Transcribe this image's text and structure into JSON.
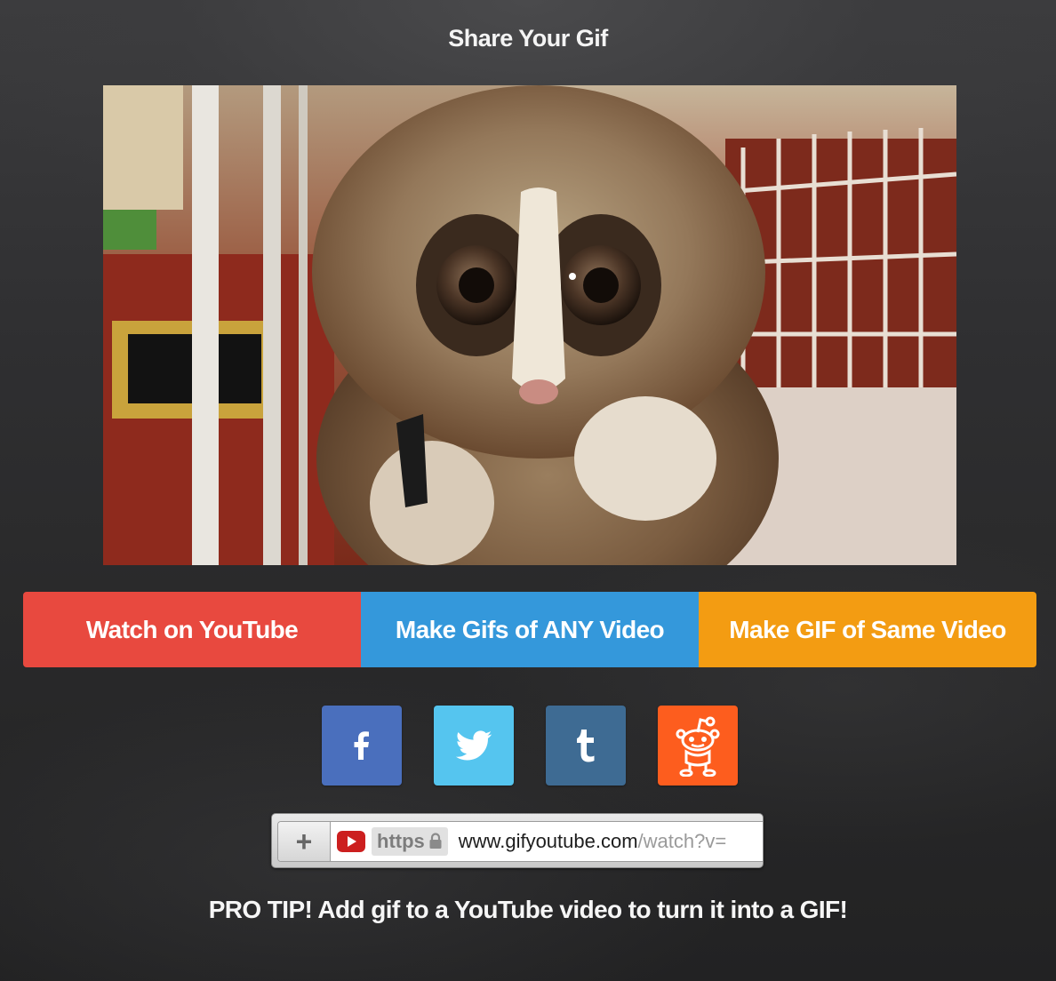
{
  "page": {
    "title": "Share Your Gif"
  },
  "gif": {
    "subject": "slow loris photo"
  },
  "actions": [
    {
      "label": "Watch on YouTube",
      "color": "#e8493f"
    },
    {
      "label": "Make Gifs of ANY Video",
      "color": "#3498db"
    },
    {
      "label": "Make GIF of Same Video",
      "color": "#f39c12"
    }
  ],
  "share": [
    {
      "network": "facebook",
      "icon": "facebook-icon",
      "color": "#4a6fbd"
    },
    {
      "network": "twitter",
      "icon": "twitter-icon",
      "color": "#55c5ef"
    },
    {
      "network": "tumblr",
      "icon": "tumblr-icon",
      "color": "#3e6b93"
    },
    {
      "network": "reddit",
      "icon": "reddit-icon",
      "color": "#fd5d1e"
    }
  ],
  "urlbar": {
    "plus": "+",
    "scheme": "https",
    "domain": "www.gifyoutube.com",
    "path": "/watch?v="
  },
  "protip": "PRO TIP! Add gif to a YouTube video to turn it into a GIF!"
}
